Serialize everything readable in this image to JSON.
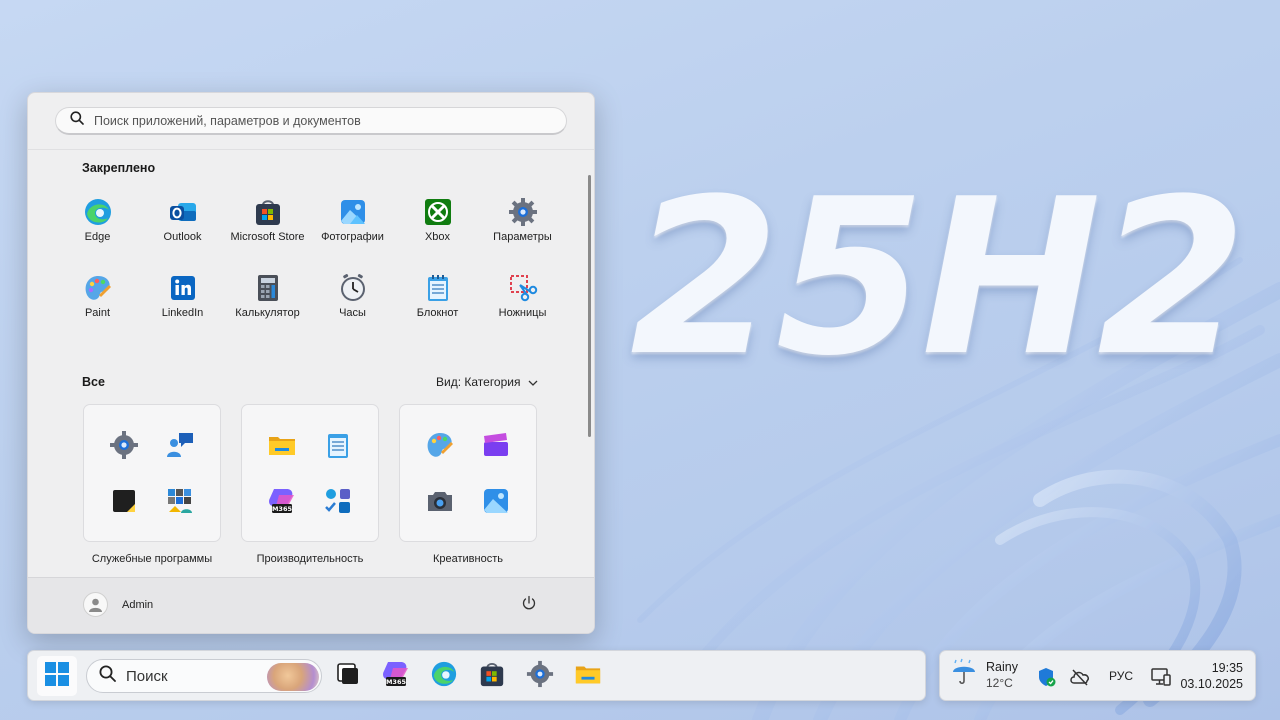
{
  "wallpaper": {
    "headline": "25H2"
  },
  "start_menu": {
    "search_placeholder": "Поиск приложений, параметров и документов",
    "pinned_title": "Закреплено",
    "pinned_apps": [
      {
        "label": "Edge",
        "icon": "edge-icon"
      },
      {
        "label": "Outlook",
        "icon": "outlook-icon"
      },
      {
        "label": "Microsoft Store",
        "icon": "store-icon"
      },
      {
        "label": "Фотографии",
        "icon": "photos-icon"
      },
      {
        "label": "Xbox",
        "icon": "xbox-icon"
      },
      {
        "label": "Параметры",
        "icon": "settings-icon"
      },
      {
        "label": "Paint",
        "icon": "paint-icon"
      },
      {
        "label": "LinkedIn",
        "icon": "linkedin-icon"
      },
      {
        "label": "Калькулятор",
        "icon": "calculator-icon"
      },
      {
        "label": "Часы",
        "icon": "clock-icon"
      },
      {
        "label": "Блокнот",
        "icon": "notepad-icon"
      },
      {
        "label": "Ножницы",
        "icon": "snipping-tool-icon"
      }
    ],
    "all_title": "Все",
    "view_label": "Вид: Категория",
    "categories": [
      {
        "label": "Служебные программы",
        "icons": [
          "settings-icon",
          "quick-assist-icon",
          "sticky-notes-icon",
          "windows-tools-icon"
        ]
      },
      {
        "label": "Производительность",
        "icons": [
          "file-explorer-icon",
          "notepad-icon",
          "m365-copilot-icon",
          "office-apps-icon"
        ]
      },
      {
        "label": "Креативность",
        "icons": [
          "paint-icon",
          "clipchamp-icon",
          "camera-icon",
          "photos-icon"
        ]
      }
    ],
    "user_name": "Admin"
  },
  "taskbar": {
    "search_label": "Поиск",
    "apps": [
      "task-view-icon",
      "m365-copilot-icon",
      "edge-icon",
      "store-icon",
      "settings-icon",
      "file-explorer-icon"
    ]
  },
  "tray": {
    "weather_condition": "Rainy",
    "weather_temp": "12°C",
    "language": "РУС",
    "time": "19:35",
    "date": "03.10.2025"
  },
  "colors": {
    "accent": "#0078d4",
    "edge": "#1f9ee0",
    "xbox": "#107c10",
    "linkedin": "#0a66c2"
  }
}
